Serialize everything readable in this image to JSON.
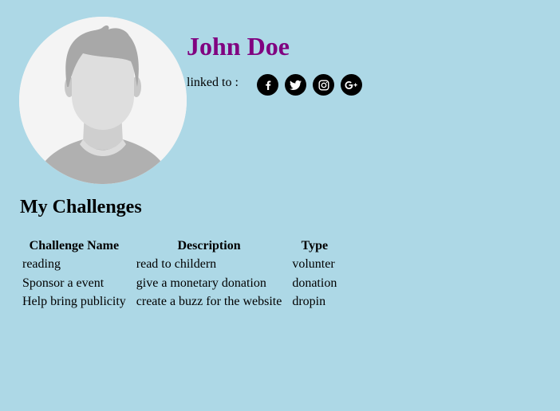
{
  "profile": {
    "name": "John Doe",
    "avatar_icon": "user-avatar-placeholder-icon"
  },
  "linked": {
    "label": "linked to :",
    "socials": [
      {
        "icon": "facebook-icon",
        "glyph": "f"
      },
      {
        "icon": "twitter-icon"
      },
      {
        "icon": "instagram-icon"
      },
      {
        "icon": "google-plus-icon",
        "glyph": "G+"
      }
    ]
  },
  "challenges": {
    "title": "My Challenges",
    "columns": [
      "Challenge Name",
      "Description",
      "Type"
    ],
    "rows": [
      [
        "reading",
        "read to childern",
        "volunter"
      ],
      [
        "Sponsor a event",
        "give a monetary donation",
        "donation"
      ],
      [
        "Help bring publicity",
        "create a buzz for the website",
        "dropin"
      ]
    ]
  },
  "colors": {
    "background": "#add8e6",
    "name": "#800080",
    "social_bg": "#000000"
  }
}
